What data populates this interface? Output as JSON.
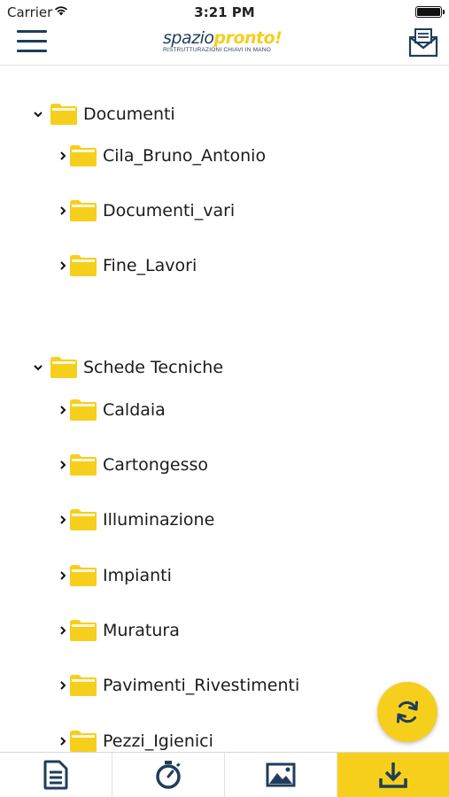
{
  "status_bar": {
    "carrier": "Carrier",
    "time": "3:21 PM"
  },
  "header": {
    "logo_part1": "spazio",
    "logo_part2": "pronto!",
    "logo_tagline": "RISTRUTTURAZIONI CHIAVI IN MANO",
    "menu_icon": "hamburger-menu-icon",
    "mail_icon": "mail-icon"
  },
  "tree": {
    "sections": [
      {
        "label": "Documenti",
        "expanded": true,
        "children": [
          "Cila_Bruno_Antonio",
          "Documenti_vari",
          "Fine_Lavori"
        ]
      },
      {
        "label": "Schede Tecniche",
        "expanded": true,
        "children": [
          "Caldaia",
          "Cartongesso",
          "Illuminazione",
          "Impianti",
          "Muratura",
          "Pavimenti_Rivestimenti",
          "Pezzi_Igienici"
        ]
      }
    ]
  },
  "fab": {
    "icon": "refresh-icon"
  },
  "tab_bar": {
    "tabs": [
      {
        "icon": "document-icon",
        "active": false
      },
      {
        "icon": "stopwatch-icon",
        "active": false
      },
      {
        "icon": "image-icon",
        "active": false
      },
      {
        "icon": "download-icon",
        "active": true
      }
    ]
  },
  "colors": {
    "accent": "#f6cf1d",
    "brand_dark": "#1f3d5b",
    "folder": "#f6cf1d"
  }
}
